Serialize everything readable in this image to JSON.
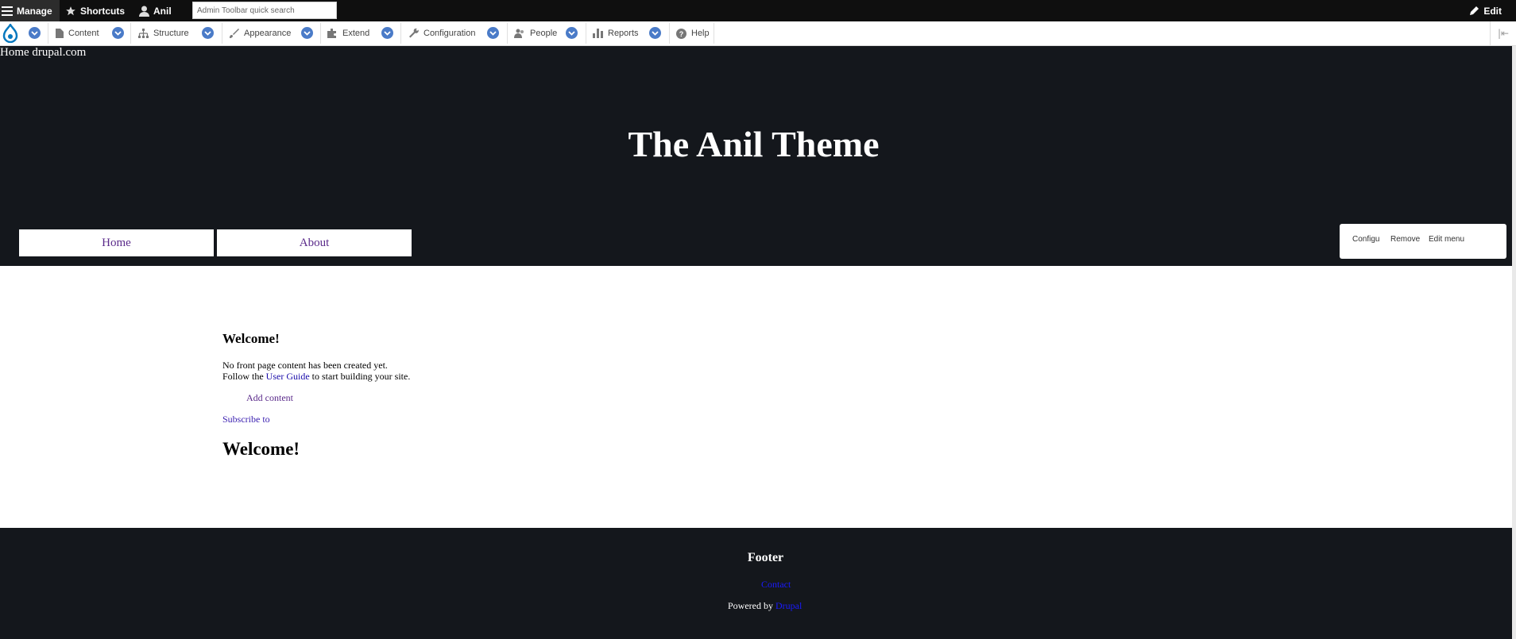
{
  "toolbar": {
    "manage": "Manage",
    "shortcuts": "Shortcuts",
    "user": "Anil",
    "search_placeholder": "Admin Toolbar quick search",
    "edit": "Edit"
  },
  "tray": {
    "items": [
      {
        "label": "Content",
        "icon": "file-icon"
      },
      {
        "label": "Structure",
        "icon": "structure-icon"
      },
      {
        "label": "Appearance",
        "icon": "paintbrush-icon"
      },
      {
        "label": "Extend",
        "icon": "puzzle-icon"
      },
      {
        "label": "Configuration",
        "icon": "wrench-icon"
      },
      {
        "label": "People",
        "icon": "people-icon"
      },
      {
        "label": "Reports",
        "icon": "bar-chart-icon"
      },
      {
        "label": "Help",
        "icon": "question-icon"
      }
    ]
  },
  "header": {
    "logo_alt": "Home drupal.com",
    "site_name": "The Anil Theme",
    "nav": [
      "Home",
      "About"
    ],
    "contextual": [
      "Configu",
      "Remove",
      "Edit menu"
    ]
  },
  "main": {
    "heading": "Welcome!",
    "line1": "No front page content has been created yet.",
    "line2_before": "Follow the ",
    "line2_link": "User Guide",
    "line2_after": " to start building your site.",
    "add_content": "Add content",
    "subscribe": "Subscribe to",
    "heading2": "Welcome!"
  },
  "footer": {
    "title": "Footer",
    "contact": "Contact",
    "powered_by": "Powered by ",
    "drupal": "Drupal"
  },
  "colors": {
    "dark_bg": "#14171c",
    "admin_bar": "#0f0f0f",
    "accent_blue": "#4a7bc8",
    "drupal_blue": "#0678be"
  }
}
